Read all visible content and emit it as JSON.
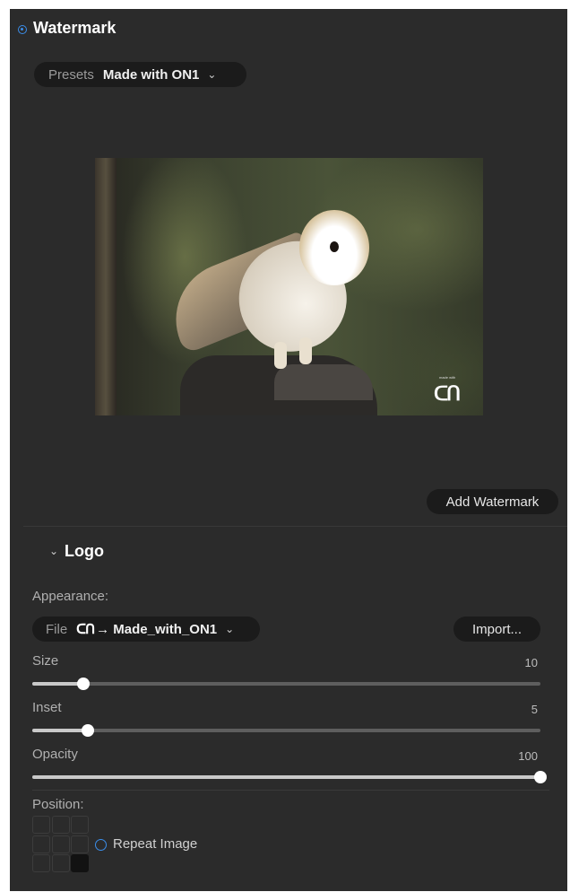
{
  "header": {
    "title": "Watermark"
  },
  "presets": {
    "label": "Presets",
    "value": "Made with ON1"
  },
  "preview": {
    "watermark_logo": "ON1-logo",
    "tiny_text": "made with"
  },
  "buttons": {
    "add_watermark": "Add Watermark",
    "import": "Import..."
  },
  "logo_section": {
    "title": "Logo",
    "appearance_label": "Appearance:",
    "file_label": "File",
    "file_logo_glyph": "ᑕᑎ",
    "file_value": "→ Made_with_ON1"
  },
  "sliders": [
    {
      "label": "Size",
      "value": "10",
      "fraction": 0.1
    },
    {
      "label": "Inset",
      "value": "5",
      "fraction": 0.11
    },
    {
      "label": "Opacity",
      "value": "100",
      "fraction": 1.0
    }
  ],
  "position": {
    "label": "Position:",
    "selected_cell": "bottom-right",
    "repeat_label": "Repeat Image"
  },
  "colors": {
    "accent": "#3b8eea",
    "panel": "#2b2b2b",
    "pill": "#1b1b1b"
  },
  "icons": {
    "header_radio": "radio-selected-icon",
    "chevron": "chevron-down-icon",
    "repeat_radio": "radio-icon"
  }
}
